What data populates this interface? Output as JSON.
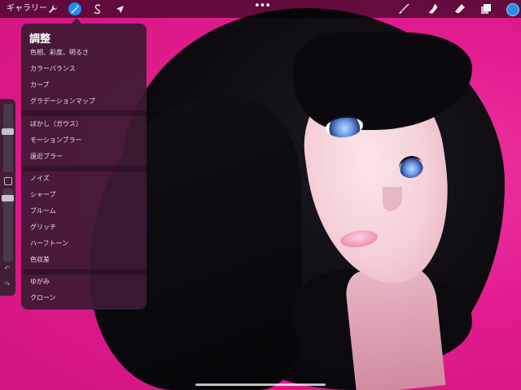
{
  "toolbar": {
    "gallery_label": "ギャラリー",
    "more_label": "•••",
    "icons": {
      "actions": "wrench-icon",
      "adjustments": "magic-wand-icon",
      "selection": "selection-icon",
      "transform": "arrow-cursor-icon",
      "brush": "brush-icon",
      "smudge": "smudge-icon",
      "eraser": "eraser-icon",
      "layers": "layers-icon"
    },
    "accent_color": "#1f8cf5",
    "current_color": "#2d8ee8"
  },
  "adjustments_panel": {
    "title": "調整",
    "groups": [
      [
        "色相、彩度、明るさ",
        "カラーバランス",
        "カーブ",
        "グラデーションマップ"
      ],
      [
        "ぼかし（ガウス）",
        "モーションブラー",
        "遠近ブラー"
      ],
      [
        "ノイズ",
        "シャープ",
        "ブルーム",
        "グリッチ",
        "ハーフトーン",
        "色収差"
      ],
      [
        "ゆがみ",
        "クローン"
      ]
    ]
  },
  "sidebar": {
    "undo_glyph": "↶",
    "redo_glyph": "↷"
  },
  "canvas": {
    "background_color": "#e21c8f"
  }
}
